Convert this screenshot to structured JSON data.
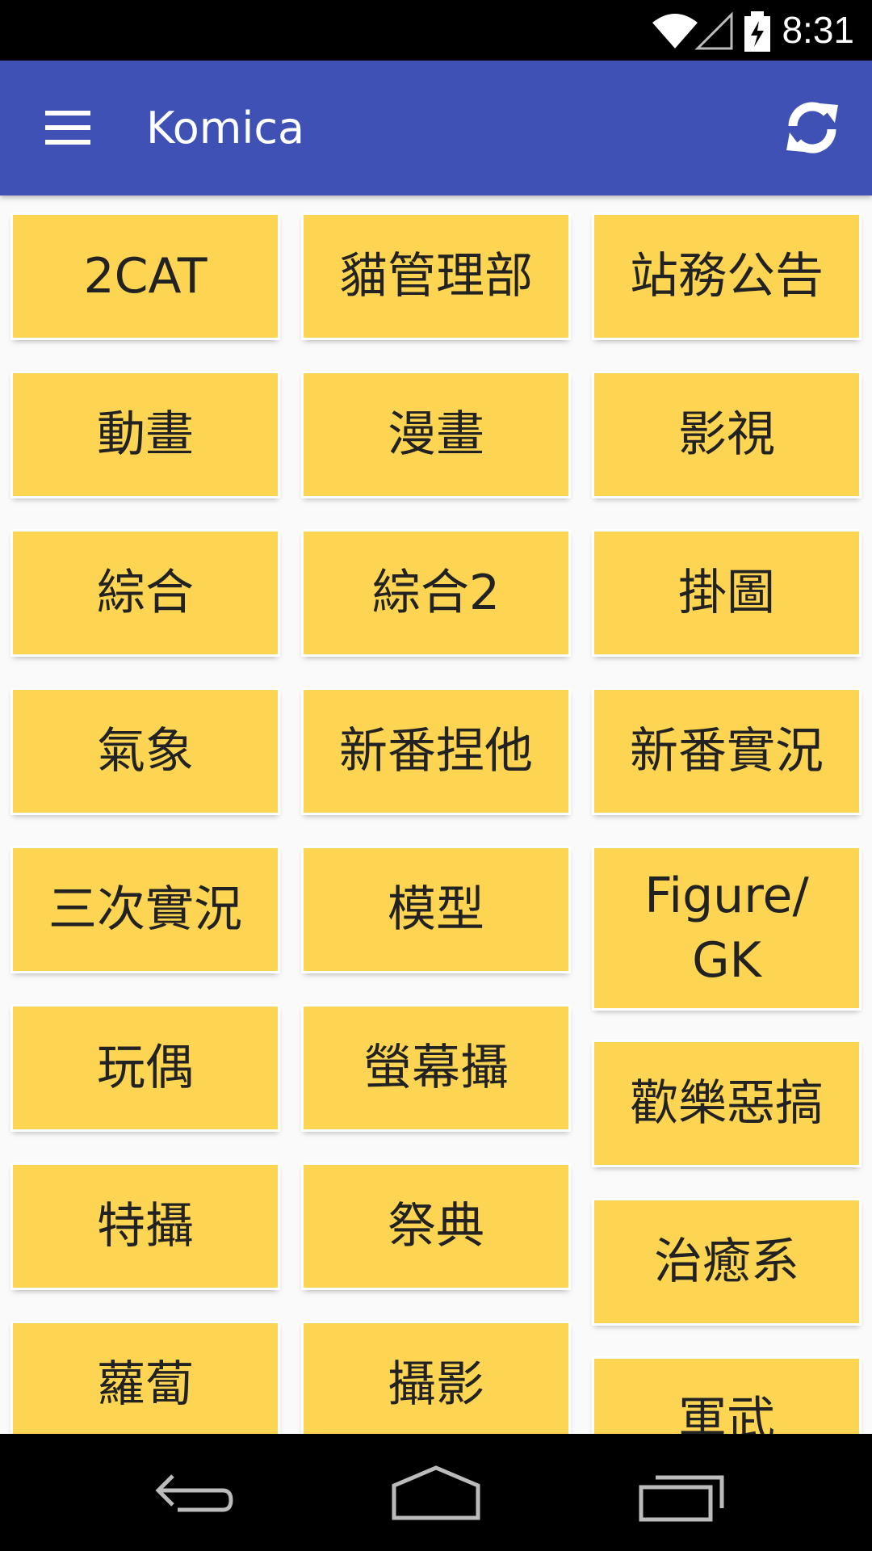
{
  "status_bar": {
    "time": "8:31",
    "icons": [
      "wifi-icon",
      "signal-icon",
      "battery-charging-icon"
    ]
  },
  "app_bar": {
    "title": "Komica",
    "menu_icon": "hamburger-menu-icon",
    "refresh_icon": "refresh-icon",
    "color": "#3f51b5"
  },
  "boards": {
    "col1": [
      "2CAT",
      "動畫",
      "綜合",
      "氣象",
      "三次實況",
      "玩偶",
      "特攝",
      "蘿蔔"
    ],
    "col2": [
      "貓管理部",
      "漫畫",
      "綜合2",
      "新番捏他",
      "模型",
      "螢幕攝",
      "祭典",
      "攝影"
    ],
    "col3": [
      "站務公告",
      "影視",
      "掛圖",
      "新番實況",
      "Figure/\nGK",
      "歡樂惡搞",
      "治癒系",
      "軍武"
    ]
  },
  "colors": {
    "button": "#fdd552",
    "background": "#fafafa"
  },
  "nav_bar": {
    "icons": [
      "back-icon",
      "home-icon",
      "recents-icon"
    ]
  }
}
